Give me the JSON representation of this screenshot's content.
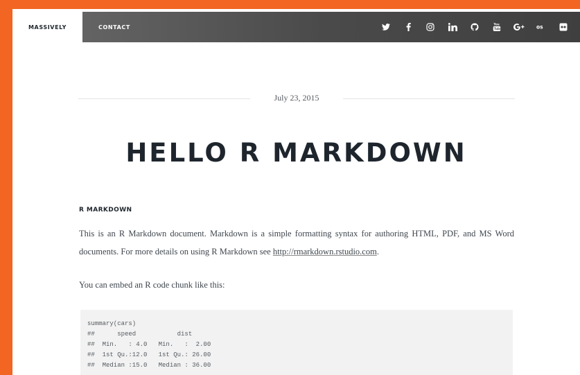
{
  "nav": {
    "brand": "MASSIVELY",
    "links": [
      "CONTACT"
    ],
    "icons": [
      "twitter-icon",
      "facebook-icon",
      "instagram-icon",
      "linkedin-icon",
      "github-icon",
      "youtube-icon",
      "google-plus-icon",
      "lastfm-icon",
      "flickr-icon"
    ]
  },
  "post": {
    "date": "July 23, 2015",
    "title": "HELLO R MARKDOWN",
    "section_heading": "R MARKDOWN",
    "para1_text": "This is an R Markdown document. Markdown is a simple formatting syntax for authoring HTML, PDF, and MS Word documents. For more details on using R Markdown see ",
    "para1_link": "http://rmarkdown.rstudio.com",
    "para1_end": ".",
    "para2": "You can embed an R code chunk like this:",
    "code_lines": [
      "summary(cars)",
      "##      speed           dist       ",
      "##  Min.   : 4.0   Min.   :  2.00  ",
      "##  1st Qu.:12.0   1st Qu.: 26.00  ",
      "##  Median :15.0   Median : 36.00  "
    ]
  },
  "colors": {
    "frame": "#f26522",
    "text_dark": "#1e252d",
    "text_body": "#3f464d"
  }
}
